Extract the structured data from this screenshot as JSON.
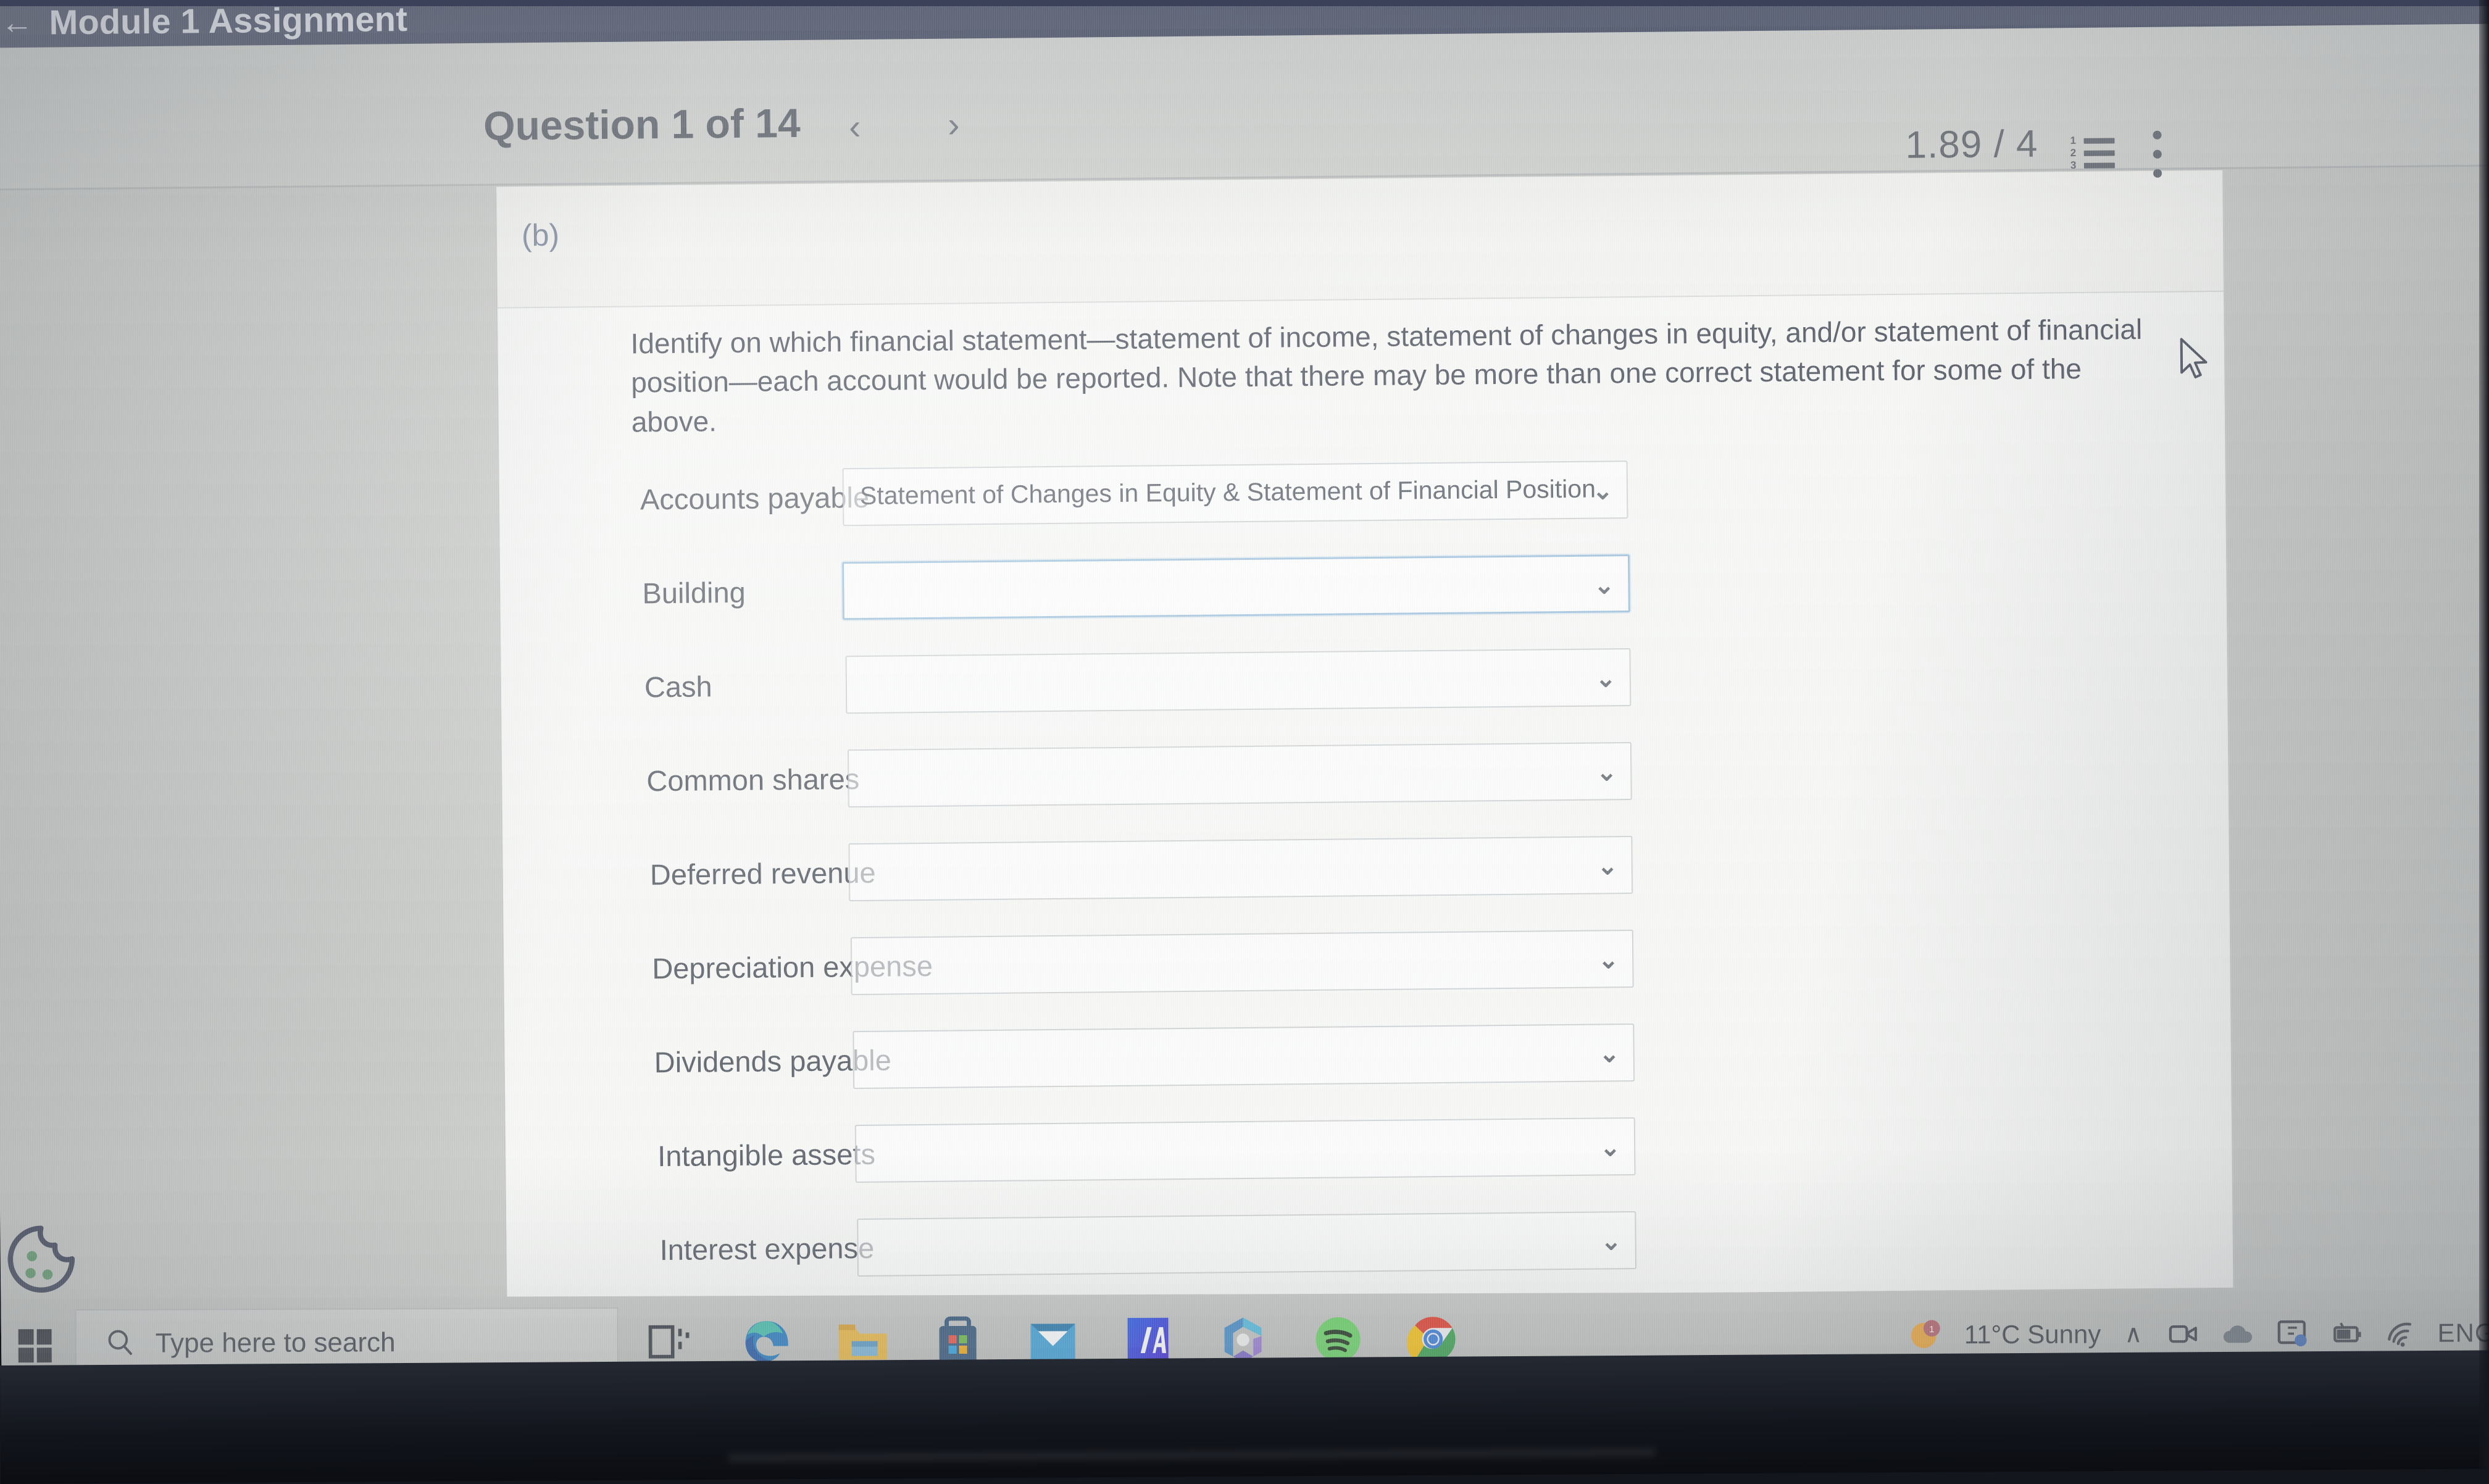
{
  "app": {
    "back_icon": "back-arrow-icon",
    "title": "Module 1 Assignment"
  },
  "toolbar": {
    "question_title": "Question 1 of 14",
    "prev_label": "‹",
    "next_label": "›",
    "score": "1.89 / 4",
    "list_icon": "numbered-list-icon",
    "menu_icon": "kebab-menu-icon"
  },
  "question": {
    "part_label": "(b)",
    "instructions": "Identify on which financial statement—statement of income, statement of changes in equity, and/or statement of financial position—each account would be reported. Note that there may be more than one correct statement for some of the above.",
    "chevron_icon": "chevron-down-icon",
    "rows": [
      {
        "label": "Accounts payable",
        "value": "Statement of Changes in Equity & Statement of Financial Position",
        "focused": false
      },
      {
        "label": "Building",
        "value": "",
        "focused": true
      },
      {
        "label": "Cash",
        "value": "",
        "focused": false
      },
      {
        "label": "Common shares",
        "value": "",
        "focused": false
      },
      {
        "label": "Deferred revenue",
        "value": "",
        "focused": false
      },
      {
        "label": "Depreciation expense",
        "value": "",
        "focused": false
      },
      {
        "label": "Dividends payable",
        "value": "",
        "focused": false
      },
      {
        "label": "Intangible assets",
        "value": "",
        "focused": false
      },
      {
        "label": "Interest expense",
        "value": "",
        "focused": false
      }
    ]
  },
  "overlay": {
    "cookie_icon": "cookie-consent-icon",
    "cursor_icon": "mouse-pointer-icon"
  },
  "taskbar": {
    "start_icon": "windows-start-icon",
    "search_placeholder": "Type here to search",
    "search_icon": "search-icon",
    "apps": [
      {
        "name": "task-view-icon",
        "label": "Task View"
      },
      {
        "name": "edge-icon",
        "label": "Microsoft Edge"
      },
      {
        "name": "file-explorer-icon",
        "label": "File Explorer"
      },
      {
        "name": "microsoft-store-icon",
        "label": "Microsoft Store"
      },
      {
        "name": "mail-icon",
        "label": "Mail"
      },
      {
        "name": "ia-app-icon",
        "label": "IA"
      },
      {
        "name": "microsoft-365-icon",
        "label": "Microsoft 365"
      },
      {
        "name": "spotify-icon",
        "label": "Spotify"
      },
      {
        "name": "chrome-icon",
        "label": "Google Chrome"
      }
    ],
    "tray": {
      "weather_icon": "weather-sunny-icon",
      "weather_text": "11°C  Sunny",
      "chevron_up": "∧",
      "icons": [
        "meet-now-icon",
        "onedrive-icon",
        "user-account-icon",
        "battery-icon",
        "wifi-icon"
      ],
      "language": "ENG"
    }
  },
  "colors": {
    "header_navy": "#444b63",
    "toolbar_gray": "#d2d4d1",
    "card_bg": "#f7f8f6",
    "text_gray": "#5a6068",
    "focus_blue": "#9fc2de",
    "accent_blue": "#2f6fd0"
  }
}
